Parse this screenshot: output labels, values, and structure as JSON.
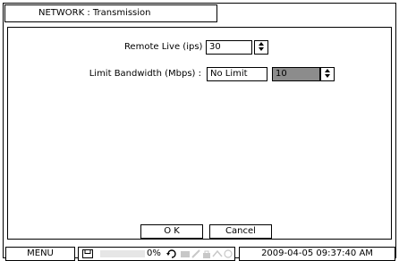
{
  "window": {
    "title": "NETWORK : Transmission"
  },
  "form": {
    "remote_live": {
      "label": "Remote Live (ips) :",
      "value": "30"
    },
    "limit_bandwidth": {
      "label": "Limit Bandwidth (Mbps) :",
      "mode": "No Limit",
      "value": "10"
    }
  },
  "buttons": {
    "ok": "O K",
    "cancel": "Cancel"
  },
  "statusbar": {
    "menu": "MENU",
    "progress_text": "0%",
    "progress_fraction": 0,
    "datetime": "2009-04-05 09:37:40 AM"
  },
  "icons": {
    "spinner": "up-down-arrows",
    "disk": "disk-icon",
    "refresh": "refresh-icon",
    "status_icons": [
      "camera-icon",
      "record-icon",
      "lock-icon",
      "network-icon",
      "clock-icon"
    ]
  },
  "colors": {
    "selected_field": "#8c8c8c",
    "progress_fill": "#888888",
    "dim_icon": "#c8c8c8"
  }
}
